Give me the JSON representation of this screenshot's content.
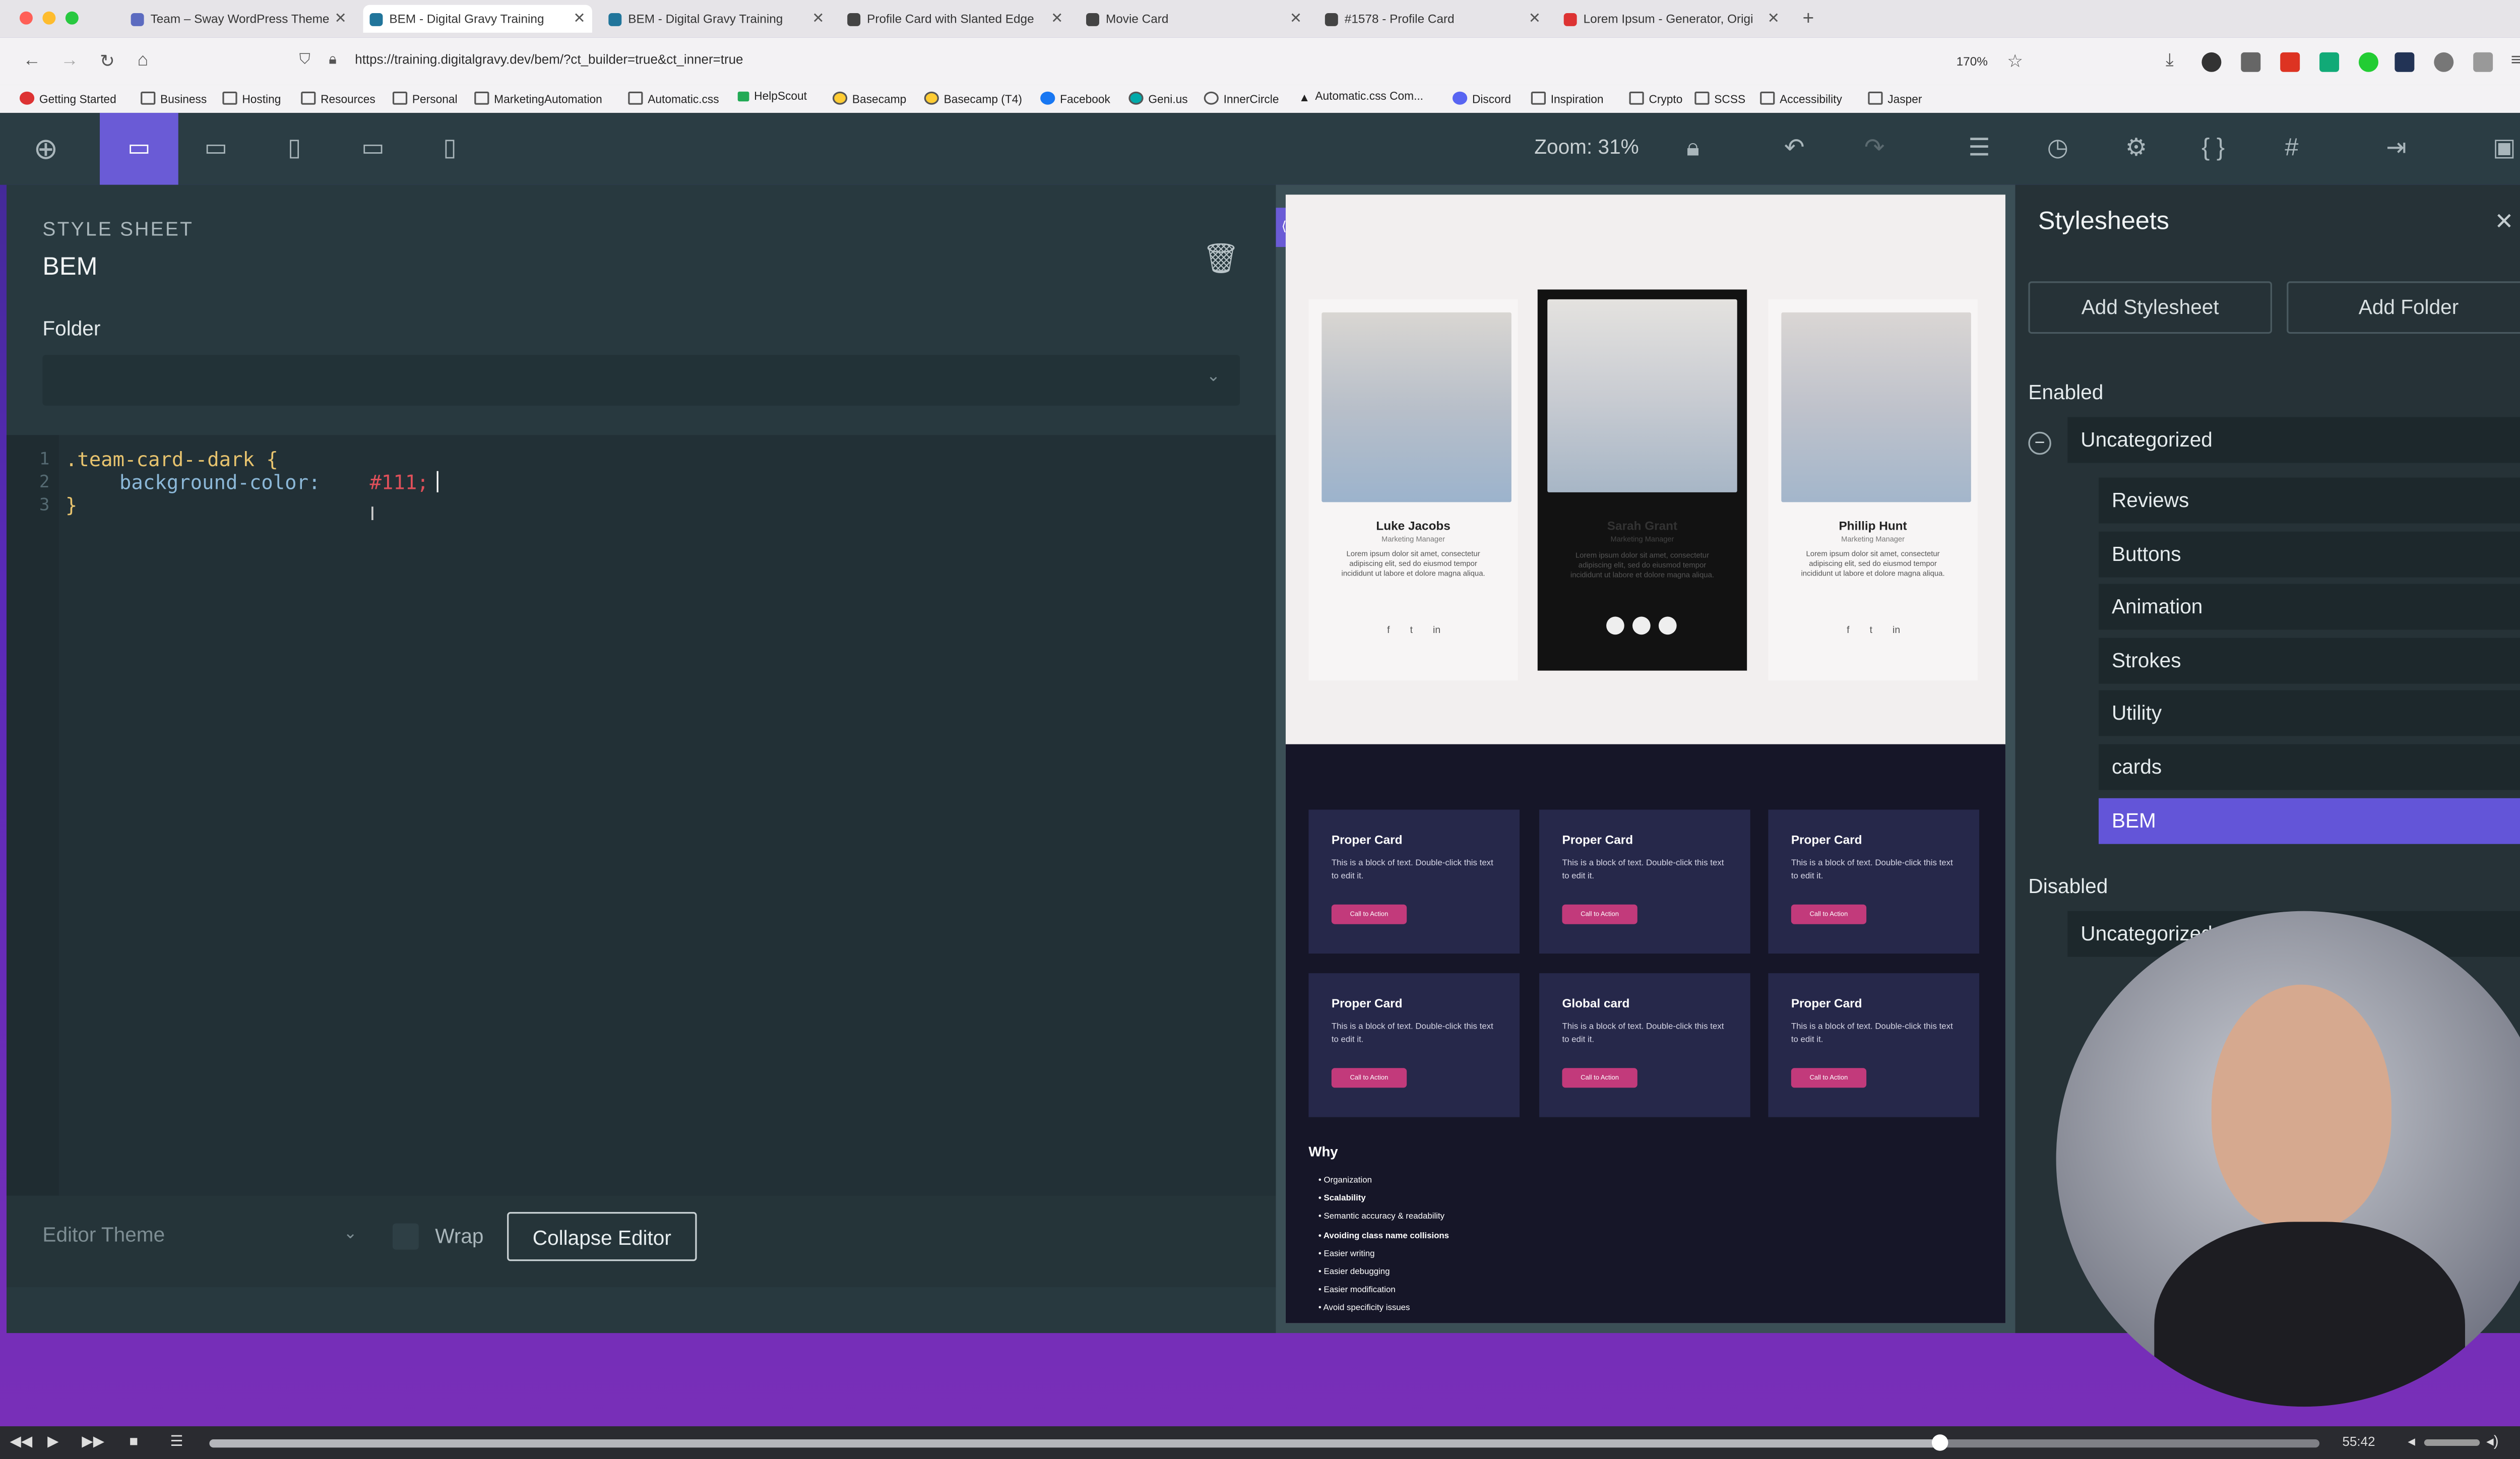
{
  "browser": {
    "tabs": [
      {
        "label": "Team – Sway WordPress Theme"
      },
      {
        "label": "BEM - Digital Gravy Training"
      },
      {
        "label": "BEM - Digital Gravy Training"
      },
      {
        "label": "Profile Card with Slanted Edge"
      },
      {
        "label": "Movie Card"
      },
      {
        "label": "#1578 - Profile Card"
      },
      {
        "label": "Lorem Ipsum - Generator, Origi"
      }
    ],
    "url": "https://training.digitalgravy.dev/bem/?ct_builder=true&ct_inner=true",
    "url_zoom": "170%",
    "bookmarks": [
      "Getting Started",
      "Business",
      "Hosting",
      "Resources",
      "Personal",
      "MarketingAutomation",
      "Automatic.css",
      "HelpScout",
      "Basecamp",
      "Basecamp (T4)",
      "Facebook",
      "Geni.us",
      "InnerCircle",
      "Automatic.css Com...",
      "Discord",
      "Inspiration",
      "Crypto",
      "SCSS",
      "Accessibility",
      "Jasper"
    ]
  },
  "toolbar": {
    "zoom_label": "Zoom: 31%"
  },
  "editor": {
    "heading": "STYLE SHEET",
    "sheet_name": "BEM",
    "folder_label": "Folder",
    "folder_value": "",
    "code_lines": [
      ".team-card--dark {",
      "    background-color: #111;",
      "}"
    ],
    "code_parts": {
      "prop": "background-color:",
      "value": "#111;"
    },
    "line_numbers": [
      "1",
      "2",
      "3"
    ],
    "theme_label": "Editor Theme",
    "wrap_label": "Wrap",
    "collapse_label": "Collapse Editor"
  },
  "preview": {
    "team": [
      {
        "name": "Luke Jacobs",
        "role": "Marketing Manager",
        "desc": "Lorem ipsum dolor sit amet, consectetur adipiscing elit, sed do eiusmod tempor incididunt ut labore et dolore magna aliqua."
      },
      {
        "name": "Sarah Grant",
        "role": "Marketing Manager",
        "desc": "Lorem ipsum dolor sit amet, consectetur adipiscing elit, sed do eiusmod tempor incididunt ut labore et dolore magna aliqua."
      },
      {
        "name": "Phillip Hunt",
        "role": "Marketing Manager",
        "desc": "Lorem ipsum dolor sit amet, consectetur adipiscing elit, sed do eiusmod tempor incididunt ut labore et dolore magna aliqua."
      }
    ],
    "cards": [
      {
        "title": "Proper Card",
        "text": "This is a block of text. Double-click this text to edit it.",
        "button": "Call to Action"
      },
      {
        "title": "Proper Card",
        "text": "This is a block of text. Double-click this text to edit it.",
        "button": "Call to Action"
      },
      {
        "title": "Proper Card",
        "text": "This is a block of text. Double-click this text to edit it.",
        "button": "Call to Action"
      },
      {
        "title": "Proper Card",
        "text": "This is a block of text. Double-click this text to edit it.",
        "button": "Call to Action"
      },
      {
        "title": "Global card",
        "text": "This is a block of text. Double-click this text to edit it.",
        "button": "Call to Action"
      },
      {
        "title": "Proper Card",
        "text": "This is a block of text. Double-click this text to edit it.",
        "button": "Call to Action"
      }
    ],
    "why_title": "Why",
    "why_items": [
      "Organization",
      "Scalability",
      "Semantic accuracy & readability",
      "Avoiding class name collisions",
      "Easier writing",
      "Easier debugging",
      "Easier modification",
      "Avoid specificity issues"
    ]
  },
  "stylesheets": {
    "title": "Stylesheets",
    "add_stylesheet": "Add Stylesheet",
    "add_folder": "Add Folder",
    "enabled_label": "Enabled",
    "folder": "Uncategorized",
    "items": [
      "Reviews",
      "Buttons",
      "Animation",
      "Strokes",
      "Utility",
      "cards",
      "BEM"
    ],
    "active": "BEM",
    "disabled_label": "Disabled",
    "disabled_folder": "Uncategorized"
  },
  "video": {
    "time": "55:42",
    "progress": 0.82
  },
  "colors": {
    "accent": "#6a5bd6",
    "cta": "#c23a7b",
    "code_value": "#e0505a"
  }
}
